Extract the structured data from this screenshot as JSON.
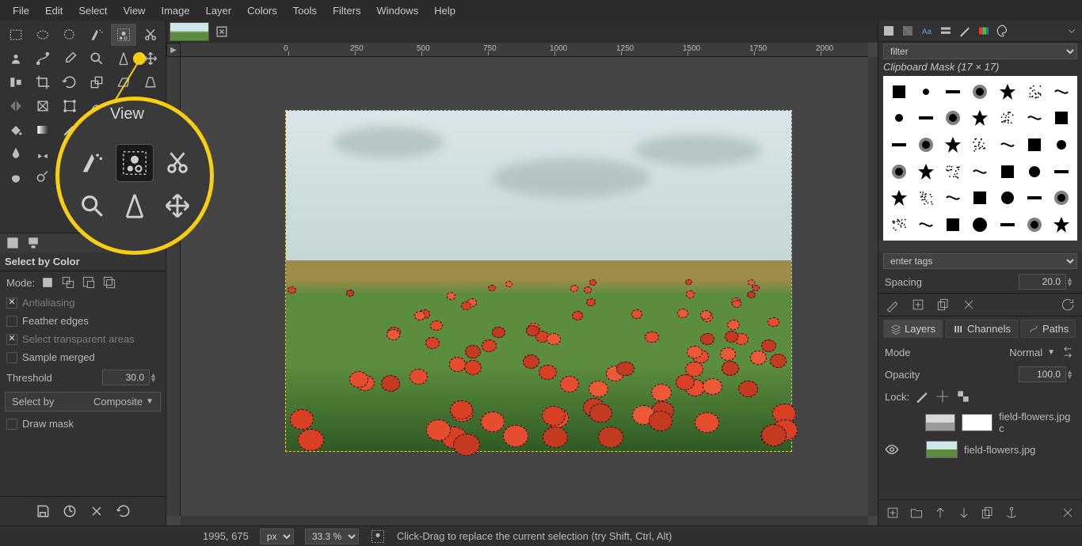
{
  "menubar": [
    "File",
    "Edit",
    "Select",
    "View",
    "Image",
    "Layer",
    "Colors",
    "Tools",
    "Filters",
    "Windows",
    "Help"
  ],
  "tool_options": {
    "title": "Select by Color",
    "mode_label": "Mode:",
    "antialiasing": "Antialiasing",
    "feather": "Feather edges",
    "transparent": "Select transparent areas",
    "sample_merged": "Sample merged",
    "threshold_label": "Threshold",
    "threshold_value": "30.0",
    "select_by_label": "Select by",
    "select_by_value": "Composite",
    "draw_mask": "Draw mask"
  },
  "ruler_ticks": [
    "0",
    "250",
    "500",
    "750",
    "1000",
    "1250",
    "1500",
    "1750",
    "2000"
  ],
  "status": {
    "coord": "1995, 675",
    "unit": "px",
    "zoom": "33.3 %",
    "hint": "Click-Drag to replace the current selection (try Shift, Ctrl, Alt)"
  },
  "brushes": {
    "title": "Clipboard Mask (17 × 17)",
    "filter_placeholder": "filter",
    "tags_placeholder": "enter tags",
    "spacing_label": "Spacing",
    "spacing_value": "20.0"
  },
  "layers": {
    "tabs": [
      "Layers",
      "Channels",
      "Paths"
    ],
    "mode_label": "Mode",
    "mode_value": "Normal",
    "opacity_label": "Opacity",
    "opacity_value": "100.0",
    "lock_label": "Lock:",
    "items": [
      {
        "name": "field-flowers.jpg c",
        "gray": true
      },
      {
        "name": "field-flowers.jpg",
        "gray": false
      }
    ]
  },
  "lens_label": "View"
}
